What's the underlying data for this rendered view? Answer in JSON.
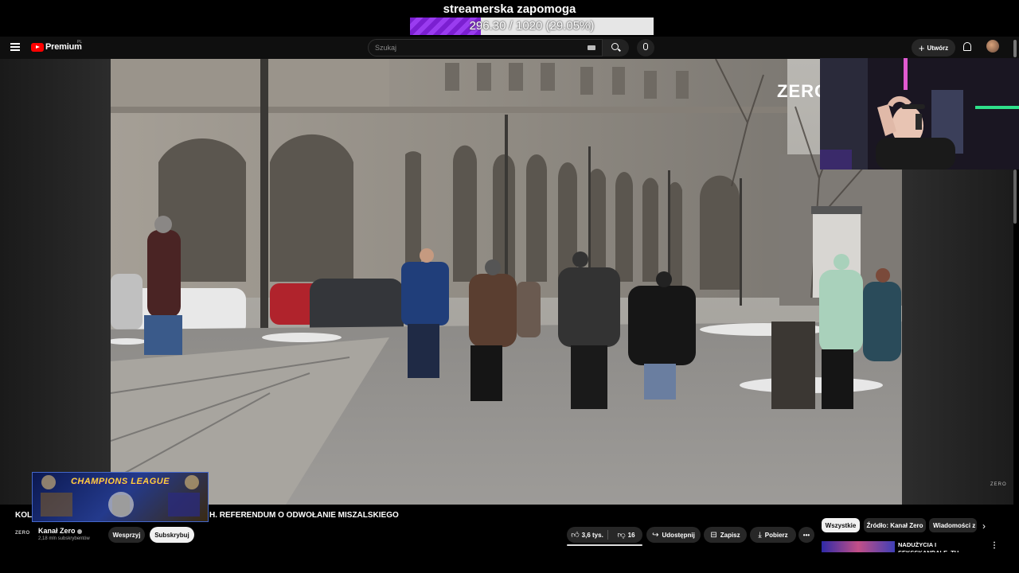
{
  "overlay": {
    "goal_title": "streamerska zapomoga",
    "goal_progress_text": "296.30 / 1020 (29.05%)",
    "goal_fraction": 0.2905,
    "goal_color": "#8a2be2"
  },
  "header": {
    "logo_text": "Premium",
    "logo_region": "PL",
    "search_placeholder": "Szukaj",
    "create_label": "Utwórz"
  },
  "player": {
    "watermark_big": "ZERO",
    "watermark_small": "ZERO"
  },
  "overlay_badge": {
    "text": "CHAMPIONS LEAGUE"
  },
  "video": {
    "title_visible_start": "KOL",
    "title_visible_end": "H. REFERENDUM O ODWOŁANIE MISZALSKIEGO",
    "channel_logo_text": "ZERO",
    "channel_name": "Kanał Zero",
    "subscribers": "2,18 mln subskrybentów",
    "support_label": "Wesprzyj",
    "subscribe_label": "Subskrybuj",
    "likes": "3,6 tys.",
    "comments": "16",
    "share_label": "Udostępnij",
    "save_label": "Zapisz",
    "download_label": "Pobierz"
  },
  "sidebar": {
    "chips": [
      "Wszystkie",
      "Źródło: Kanał Zero",
      "Wiadomości z"
    ],
    "next_title": "NADUŻYCIA I SEKSSKANDALE. TU WŁADZE BEZRADNE!"
  },
  "icons": {
    "menu": "menu-icon",
    "search": "search-icon",
    "mic": "mic-icon",
    "bell": "bell-icon",
    "like": "thumbs-up-icon",
    "dislike": "thumbs-down-icon",
    "share": "share-icon",
    "save": "bookmark-icon",
    "download": "download-icon"
  }
}
